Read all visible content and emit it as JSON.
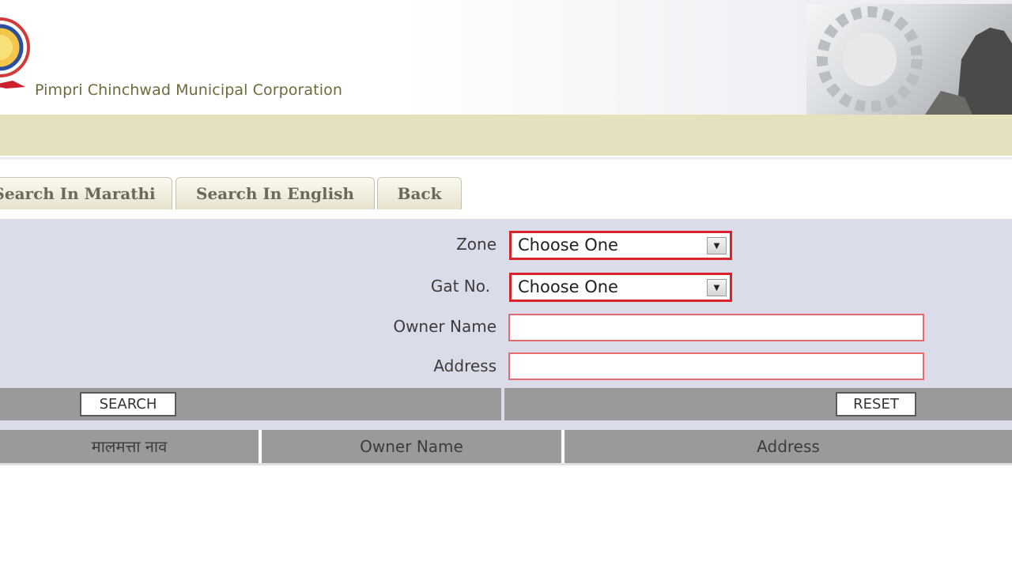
{
  "header": {
    "org_name": "Pimpri Chinchwad Municipal Corporation"
  },
  "tabs": [
    {
      "label": "Search In Marathi"
    },
    {
      "label": "Search In English"
    },
    {
      "label": "Back"
    }
  ],
  "form": {
    "zone": {
      "label": "Zone",
      "value": "Choose One"
    },
    "gat_no": {
      "label": "Gat No.",
      "value": "Choose One"
    },
    "owner_name": {
      "label": "Owner Name",
      "value": ""
    },
    "address": {
      "label": "Address",
      "value": ""
    }
  },
  "buttons": {
    "search": "SEARCH",
    "reset": "RESET"
  },
  "results": {
    "columns": [
      "मालमत्ता नाव",
      "Owner Name",
      "Address"
    ]
  },
  "colors": {
    "band": "#e5e0bd",
    "panel": "#dadcea",
    "accent_red": "#d8232a",
    "grey_bar": "#9a9a9a"
  }
}
